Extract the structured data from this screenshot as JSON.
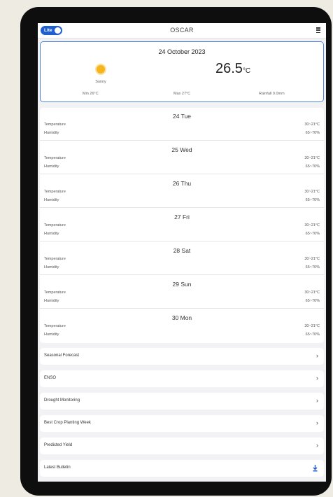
{
  "header": {
    "toggle_label": "Lite",
    "app_title": "OSCAR",
    "menu_icon": "hamburger-icon"
  },
  "today": {
    "date": "24 October 2023",
    "condition": "Sunny",
    "condition_icon": "sun-icon",
    "temperature": "26.5",
    "temperature_unit": "°C",
    "min": "Min 26°C",
    "max": "Max 27°C",
    "rainfall": "Rainfall 0.0mm"
  },
  "forecast": [
    {
      "day": "24 Tue",
      "temp_label": "Temperature",
      "temp_value": "30~21°C",
      "hum_label": "Humidity",
      "hum_value": "65~70%"
    },
    {
      "day": "25 Wed",
      "temp_label": "Temperature",
      "temp_value": "30~21°C",
      "hum_label": "Humidity",
      "hum_value": "65~70%"
    },
    {
      "day": "26 Thu",
      "temp_label": "Temperature",
      "temp_value": "30~21°C",
      "hum_label": "Humidity",
      "hum_value": "65~70%"
    },
    {
      "day": "27 Fri",
      "temp_label": "Temperature",
      "temp_value": "30~21°C",
      "hum_label": "Humidity",
      "hum_value": "65~70%"
    },
    {
      "day": "28 Sat",
      "temp_label": "Temperature",
      "temp_value": "30~21°C",
      "hum_label": "Humidity",
      "hum_value": "65~70%"
    },
    {
      "day": "29 Sun",
      "temp_label": "Temperature",
      "temp_value": "30~21°C",
      "hum_label": "Humidity",
      "hum_value": "65~70%"
    },
    {
      "day": "30 Mon",
      "temp_label": "Temperature",
      "temp_value": "30~21°C",
      "hum_label": "Humidity",
      "hum_value": "65~70%"
    }
  ],
  "nav": [
    {
      "label": "Seasonal Forecast",
      "icon": "chevron-right-icon",
      "glyph": "›"
    },
    {
      "label": "ENSO",
      "icon": "chevron-right-icon",
      "glyph": "›"
    },
    {
      "label": "Drought Monitoring",
      "icon": "chevron-right-icon",
      "glyph": "›"
    },
    {
      "label": "Best Crop Planting Week",
      "icon": "chevron-right-icon",
      "glyph": "›"
    },
    {
      "label": "Predicted Yield",
      "icon": "chevron-right-icon",
      "glyph": "›"
    },
    {
      "label": "Latest Bulletin",
      "icon": "download-icon"
    }
  ],
  "colors": {
    "accent": "#1f5fd0",
    "card_border": "#4d83d8",
    "sun": "#f5b51c",
    "background": "#f2f2f4"
  }
}
